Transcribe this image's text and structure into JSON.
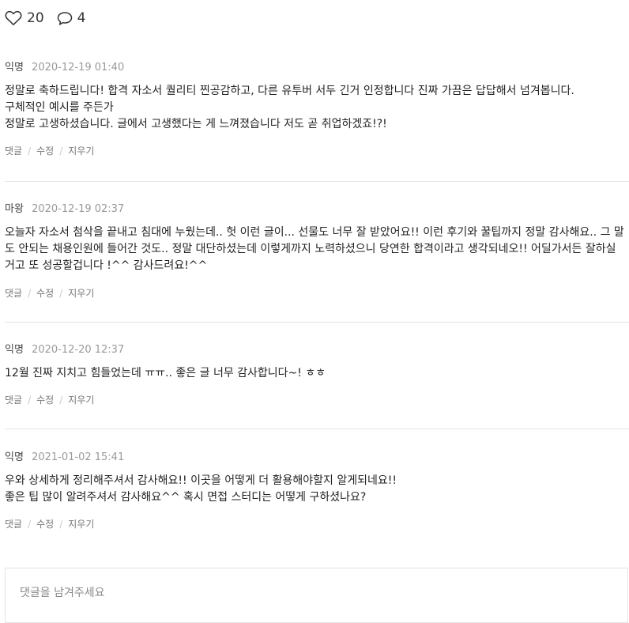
{
  "reactions": {
    "like_icon": "heart-outline-icon",
    "like_count": "20",
    "comment_icon": "speech-bubble-icon",
    "comment_count": "4"
  },
  "action_labels": {
    "reply": "댓글",
    "separator": "/",
    "edit": "수정",
    "delete": "지우기"
  },
  "comments": [
    {
      "author": "익명",
      "date": "2020-12-19 01:40",
      "lines": [
        "정말로 축하드립니다! 합격 자소서 퀄리티 찐공감하고, 다른 유투버 서두 긴거 인정합니다 진짜 가끔은 답답해서 넘겨봅니다.",
        "구체적인 예시를 주든가",
        "정말로 고생하셨습니다. 글에서 고생했다는 게 느껴졌습니다 저도 곧 취업하겠죠!?!"
      ]
    },
    {
      "author": "마왕",
      "date": "2020-12-19 02:37",
      "lines": [
        "오늘자 자소서 첨삭을 끝내고 침대에 누웠는데.. 헛 이런 글이... 선물도 너무 잘 받았어요!! 이런 후기와 꿀팁까지 정말 감사해요.. 그 말도 안되는 채용인원에 들어간 것도.. 정말 대단하셨는데 이렇게까지 노력하셨으니 당연한 합격이라고 생각되네오!! 어딜가서든 잘하실거고 또 성공할겁니다 !^^ 감사드려요!^^"
      ]
    },
    {
      "author": "익명",
      "date": "2020-12-20 12:37",
      "lines": [
        "12월 진짜 지치고 힘들었는데 ㅠㅠ.. 좋은 글 너무 감사합니다~! ㅎㅎ"
      ]
    },
    {
      "author": "익명",
      "date": "2021-01-02 15:41",
      "lines": [
        "우와 상세하게 정리해주셔서 감사해요!! 이곳을 어떻게 더 활용해야할지 알게되네요!!",
        "좋은 팁 많이 알려주셔서 감사해요^^ 혹시 면접 스터디는 어떻게 구하셨나요?"
      ]
    }
  ],
  "reply_input": {
    "placeholder": "댓글을 남겨주세요",
    "value": ""
  }
}
